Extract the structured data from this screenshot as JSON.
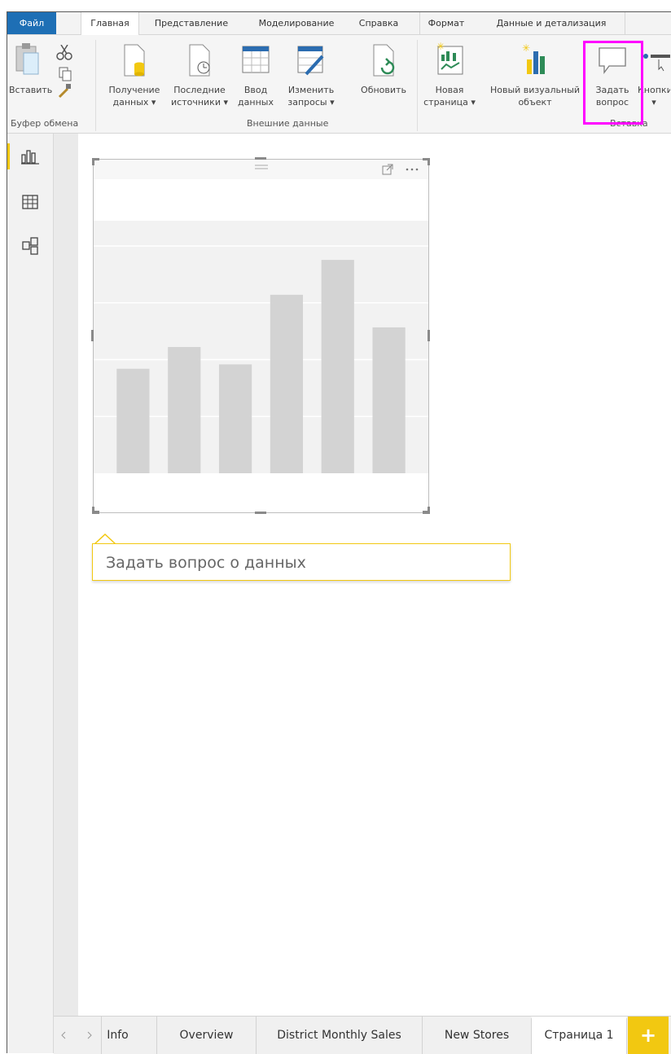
{
  "menu_tabs": {
    "file": "Файл",
    "home": "Главная",
    "view": "Представление",
    "modeling": "Моделирование",
    "help": "Справка",
    "format": "Формат",
    "data_drill": "Данные и детализация"
  },
  "ribbon": {
    "paste": "Вставить",
    "clipboard_group": "Буфер обмена",
    "get_data": [
      "Получение",
      "данных ▾"
    ],
    "recent_sources": [
      "Последние",
      "источники ▾"
    ],
    "enter_data": [
      "Ввод",
      "данных"
    ],
    "edit_queries": [
      "Изменить",
      "запросы ▾"
    ],
    "refresh": "Обновить",
    "external_data_group": "Внешние данные",
    "new_page": [
      "Новая",
      "страница ▾"
    ],
    "new_visual": [
      "Новый визуальный",
      "объект"
    ],
    "ask_question": [
      "Задать",
      "вопрос"
    ],
    "buttons": [
      "Кнопки",
      "▾"
    ],
    "insert_group": "Вставка"
  },
  "left_nav": {
    "report_icon": "report-view-icon",
    "data_icon": "data-view-icon",
    "model_icon": "model-view-icon"
  },
  "chart_data": {
    "type": "bar",
    "categories": [
      "",
      "",
      "",
      "",
      "",
      ""
    ],
    "values": [
      48,
      58,
      50,
      82,
      98,
      67
    ],
    "ylim": [
      0,
      116
    ],
    "grid": true,
    "colors": {
      "bar": "#d3d3d3",
      "plot_bg": "#f2f2f2",
      "grid": "#ffffff"
    }
  },
  "qa_box": {
    "placeholder": "Задать вопрос о данных"
  },
  "page_tabs": {
    "info": "Info",
    "overview": "Overview",
    "district": "District Monthly Sales",
    "new_stores": "New Stores",
    "page1": "Страница 1",
    "add": "+"
  },
  "colors": {
    "accent": "#f2c811",
    "file_tab": "#1e6fb5",
    "highlight": "#ff00ff"
  }
}
